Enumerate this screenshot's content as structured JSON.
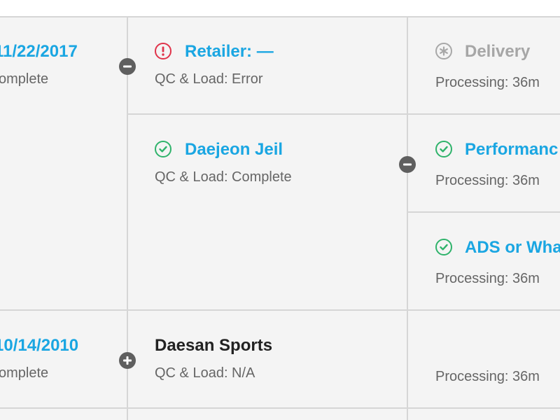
{
  "rows": [
    {
      "date": "11/22/2017",
      "date_status": "omplete",
      "toggle": "collapse",
      "retailers": [
        {
          "name": "Retailer: —",
          "status_icon": "error-icon",
          "qc_status": "QC & Load: Error",
          "deliveries": [
            {
              "name": "Delivery",
              "status_icon": "pending-icon",
              "processing": "Processing: 36m"
            }
          ]
        },
        {
          "name": "Daejeon Jeil",
          "status_icon": "check-icon",
          "qc_status": "QC & Load: Complete",
          "toggle": "collapse",
          "deliveries": [
            {
              "name": "Performanc",
              "status_icon": "check-icon",
              "processing": "Processing: 36m"
            },
            {
              "name": "ADS or Wha",
              "status_icon": "check-icon",
              "processing": "Processing: 36m"
            }
          ]
        }
      ]
    },
    {
      "date": "10/14/2010",
      "date_status": "omplete",
      "toggle": "expand",
      "retailers": [
        {
          "name": "Daesan Sports",
          "qc_status": "QC & Load: N/A",
          "deliveries": [
            {
              "processing": "Processing: 36m"
            }
          ]
        }
      ]
    }
  ],
  "colors": {
    "link": "#1aa6e2",
    "error": "#e0334a",
    "success": "#2fb36b",
    "pending": "#a8a8a8",
    "divider": "#d6d6d6",
    "background": "#f4f4f4"
  }
}
